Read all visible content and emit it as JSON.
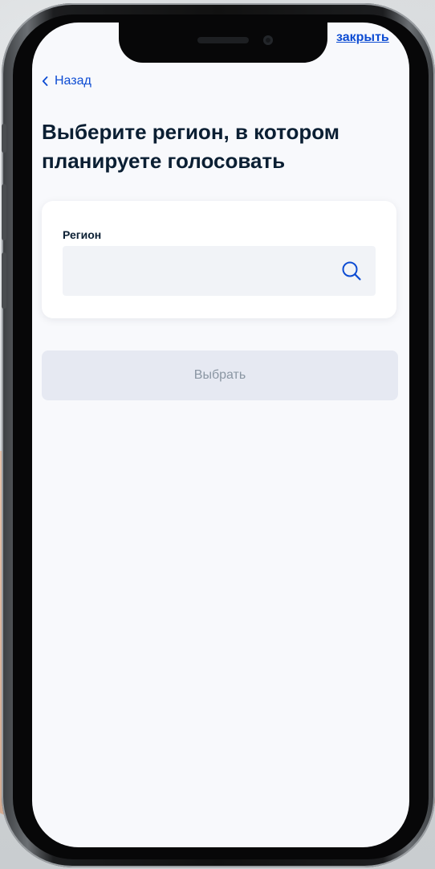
{
  "header": {
    "close_label": "закрыть",
    "back_label": "Назад"
  },
  "page": {
    "title": "Выберите регион, в котором планируете голосовать"
  },
  "region_field": {
    "label": "Регион",
    "value": "",
    "placeholder": ""
  },
  "actions": {
    "select_label": "Выбрать"
  },
  "icons": {
    "back": "chevron-left-icon",
    "search": "search-icon"
  },
  "colors": {
    "link": "#0d4cd3",
    "title": "#0b1f33",
    "screen_background": "#f8f9fc",
    "input_background": "#f1f3f7",
    "button_disabled_background": "#e6e9f2",
    "button_disabled_text": "#8a96a3"
  }
}
